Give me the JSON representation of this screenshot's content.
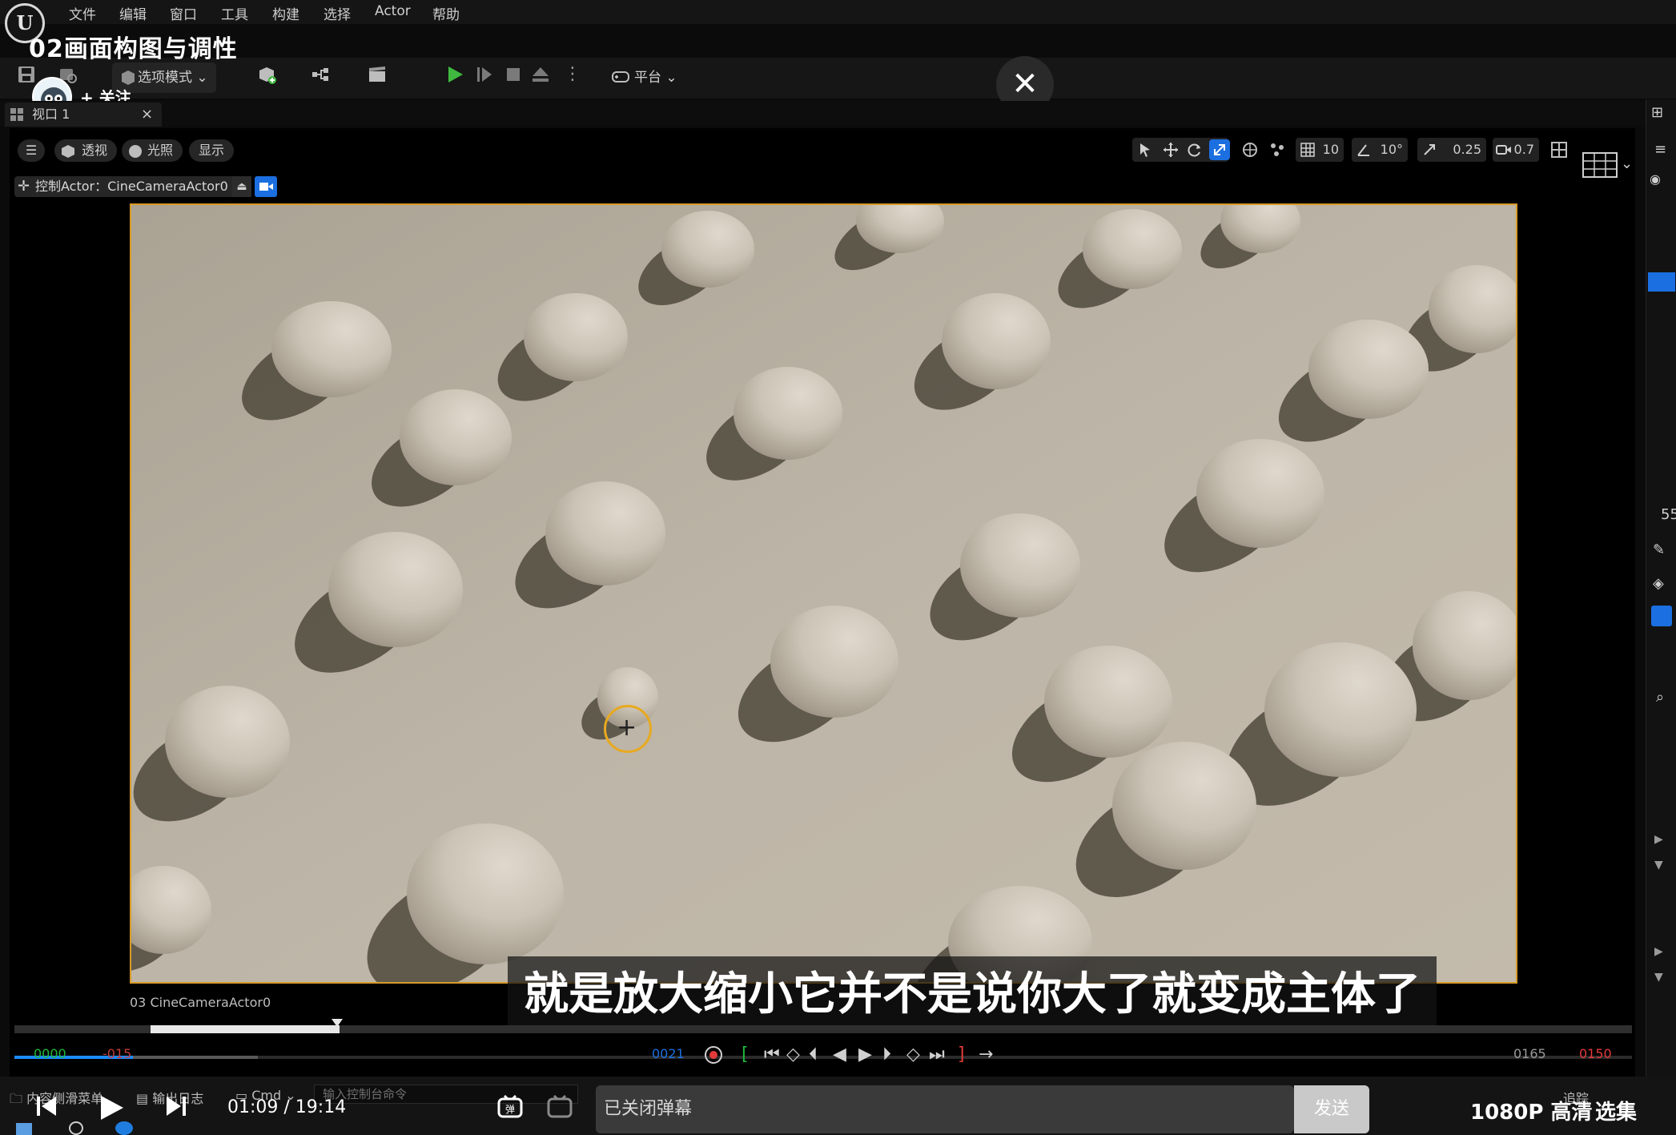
{
  "menu": {
    "items": [
      "文件",
      "编辑",
      "窗口",
      "工具",
      "构建",
      "选择",
      "Actor",
      "帮助"
    ]
  },
  "video": {
    "title": "02画面构图与调性",
    "follow_label": "+ 关注",
    "subtitle": "就是放大缩小它并不是说你大了就变成主体了",
    "time": "01:09 / 19:14",
    "danmaku_status": "已关闭弹幕",
    "send_label": "发送",
    "quality": "1080P 高清",
    "episodes": "选集"
  },
  "toolbar": {
    "mode_label": "选项模式",
    "platform_label": "平台"
  },
  "viewport": {
    "tab_label": "视口 1",
    "perspective_label": "透视",
    "lit_label": "光照",
    "show_label": "显示",
    "grid_snap": "10",
    "angle_snap": "10°",
    "scale_snap": "0.25",
    "camera_speed": "0.7",
    "pilot_label": "控制Actor：CineCameraActor0",
    "camera_name": "03 CineCameraActor0"
  },
  "timeline": {
    "start": "0000",
    "range_start": "-015",
    "current": "0021",
    "end_view": "0165",
    "end": "0150"
  },
  "bottom": {
    "content_drawer": "内容侧滑菜单",
    "output_log": "输出日志",
    "cmd": "Cmd",
    "console_placeholder": "输入控制台命令",
    "trace": "追踪"
  },
  "right_panel": {
    "value": "55"
  },
  "colors": {
    "accent_blue": "#1b8cff",
    "frame_orange": "#d89a2a",
    "play_green": "#3fb93f",
    "end_red": "#e23a3a"
  }
}
